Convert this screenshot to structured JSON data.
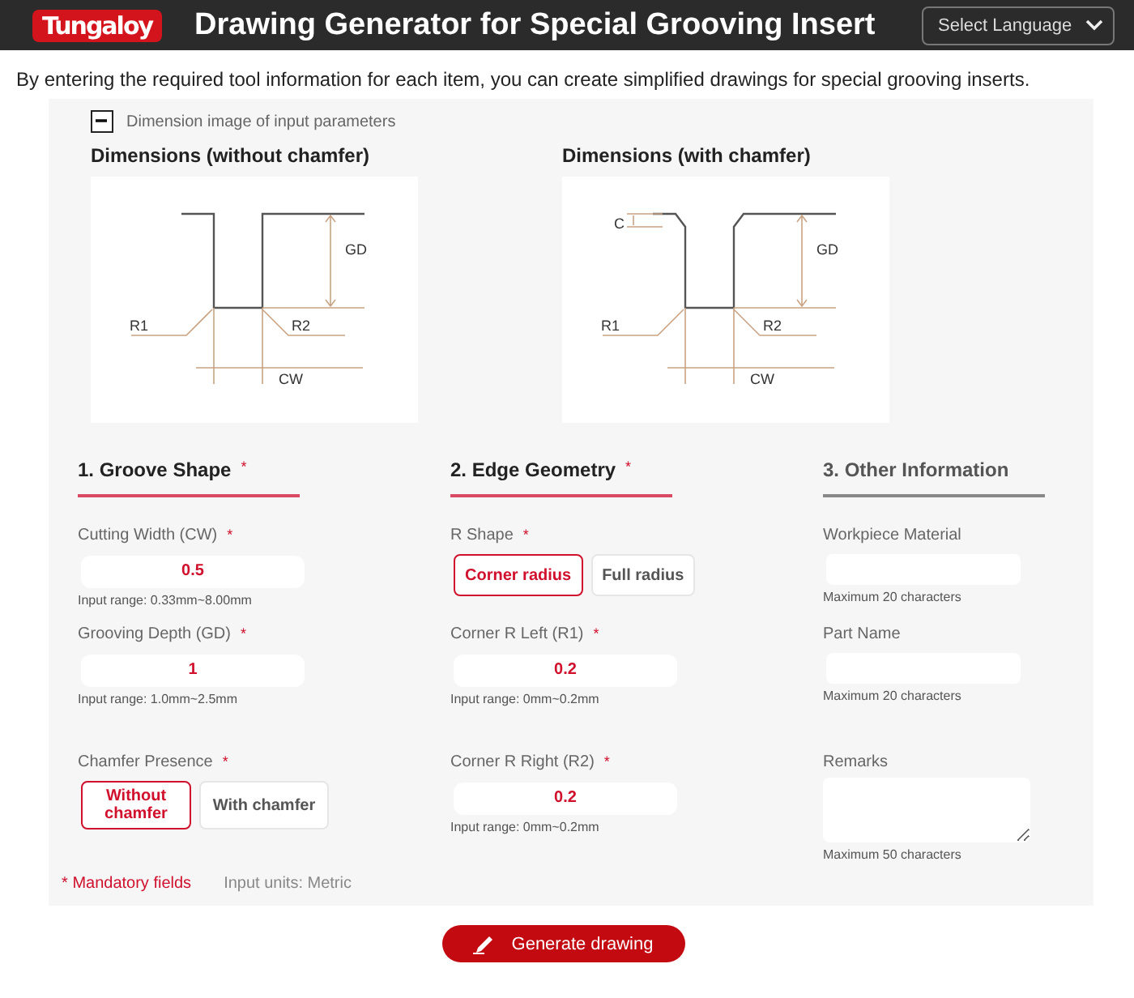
{
  "header": {
    "logo": "Tungaloy",
    "title": "Drawing Generator for Special Grooving Insert",
    "language_select": "Select Language"
  },
  "intro": "By entering the required tool information for each item, you can create simplified drawings for special grooving inserts.",
  "dimension_toggle": {
    "label": "Dimension image of input parameters",
    "expanded": true
  },
  "diagrams": [
    {
      "title": "Dimensions (without chamfer)",
      "chamfer": false,
      "labels": {
        "gd": "GD",
        "r1": "R1",
        "r2": "R2",
        "cw": "CW"
      }
    },
    {
      "title": "Dimensions (with chamfer)",
      "chamfer": true,
      "labels": {
        "c": "C",
        "gd": "GD",
        "r1": "R1",
        "r2": "R2",
        "cw": "CW"
      }
    }
  ],
  "required_mark": "*",
  "sections": [
    {
      "title": "1. Groove Shape",
      "required": true,
      "fields": [
        {
          "kind": "number",
          "label": "Cutting Width (CW)",
          "required": true,
          "value": "0.5",
          "hint": "Input range: 0.33mm~8.00mm"
        },
        {
          "kind": "number",
          "label": "Grooving Depth (GD)",
          "required": true,
          "value": "1",
          "hint": "Input range: 1.0mm~2.5mm"
        },
        {
          "kind": "choice",
          "label": "Chamfer Presence",
          "required": true,
          "options": [
            {
              "label": "Without chamfer",
              "selected": true
            },
            {
              "label": "With chamfer",
              "selected": false
            }
          ]
        }
      ]
    },
    {
      "title": "2. Edge Geometry",
      "required": true,
      "fields": [
        {
          "kind": "choice",
          "label": "R Shape",
          "required": true,
          "options": [
            {
              "label": "Corner radius",
              "selected": true
            },
            {
              "label": "Full radius",
              "selected": false
            }
          ]
        },
        {
          "kind": "number",
          "label": "Corner R Left (R1)",
          "required": true,
          "value": "0.2",
          "hint": "Input range: 0mm~0.2mm"
        },
        {
          "kind": "number",
          "label": "Corner R Right (R2)",
          "required": true,
          "value": "0.2",
          "hint": "Input range: 0mm~0.2mm"
        }
      ]
    },
    {
      "title": "3. Other Information",
      "required": false,
      "fields": [
        {
          "kind": "text",
          "label": "Workpiece Material",
          "hint": "Maximum 20 characters"
        },
        {
          "kind": "text",
          "label": "Part Name",
          "hint": "Maximum 20 characters"
        },
        {
          "kind": "textarea",
          "label": "Remarks",
          "hint": "Maximum 50 characters"
        }
      ]
    }
  ],
  "footer_notes": {
    "mandatory": "Mandatory fields",
    "units": "Input units: Metric"
  },
  "generate_button": "Generate drawing"
}
